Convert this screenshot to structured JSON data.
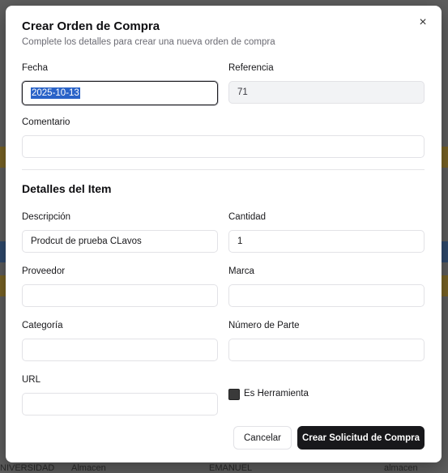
{
  "background": {
    "row_cells": [
      "NIVERSIDAD",
      "Almacen",
      "EMANUEL",
      "almacen"
    ]
  },
  "modal": {
    "title": "Crear Orden de Compra",
    "subtitle": "Complete los detalles para crear una nueva orden de compra",
    "close_icon": "×",
    "fields": {
      "fecha": {
        "label": "Fecha",
        "value": "2025-10-13"
      },
      "referencia": {
        "label": "Referencia",
        "value": "71"
      },
      "comentario": {
        "label": "Comentario",
        "value": ""
      }
    },
    "item_section_title": "Detalles del Item",
    "item": {
      "descripcion": {
        "label": "Descripción",
        "value": "Prodcut de prueba CLavos"
      },
      "cantidad": {
        "label": "Cantidad",
        "value": "1"
      },
      "proveedor": {
        "label": "Proveedor",
        "value": ""
      },
      "marca": {
        "label": "Marca",
        "value": ""
      },
      "categoria": {
        "label": "Categoría",
        "value": ""
      },
      "numero_parte": {
        "label": "Número de Parte",
        "value": ""
      },
      "url": {
        "label": "URL",
        "value": ""
      },
      "es_herramienta": {
        "label": "Es Herramienta",
        "checked": false
      }
    },
    "buttons": {
      "cancel": "Cancelar",
      "submit": "Crear Solicitud de Compra"
    }
  }
}
